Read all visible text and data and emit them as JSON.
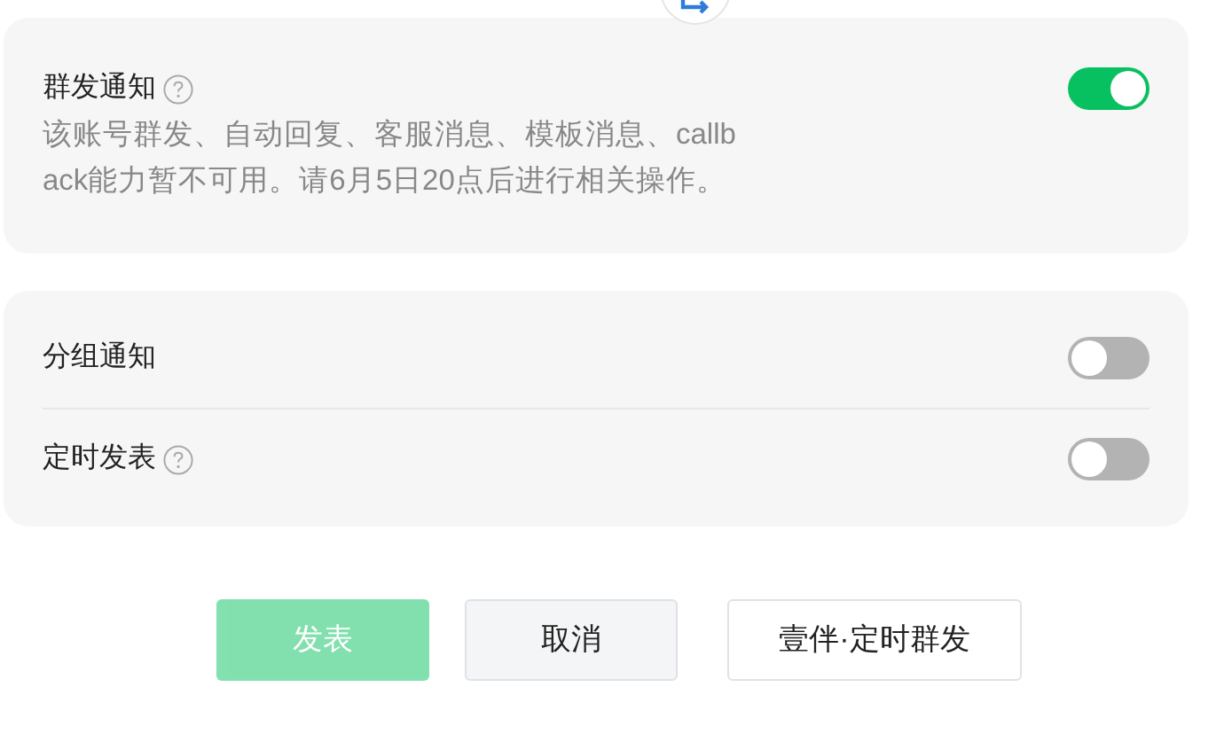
{
  "sections": [
    {
      "items": [
        {
          "label": "群发通知",
          "help": true,
          "on": true,
          "description_lines": [
            "该账号群发、自动回复、客服消息、模板消息、callb",
            "ack能力暂不可用。请6月5日20点后进行相关操作。"
          ]
        }
      ]
    },
    {
      "items": [
        {
          "label": "分组通知",
          "help": false,
          "on": false
        },
        {
          "label": "定时发表",
          "help": true,
          "on": false
        }
      ]
    }
  ],
  "buttons": [
    {
      "label": "发表",
      "kind": "primary",
      "disabled": true
    },
    {
      "label": "取消",
      "kind": "secondary",
      "disabled": false
    },
    {
      "label": "壹伴·定时群发",
      "kind": "outline",
      "disabled": false
    }
  ]
}
